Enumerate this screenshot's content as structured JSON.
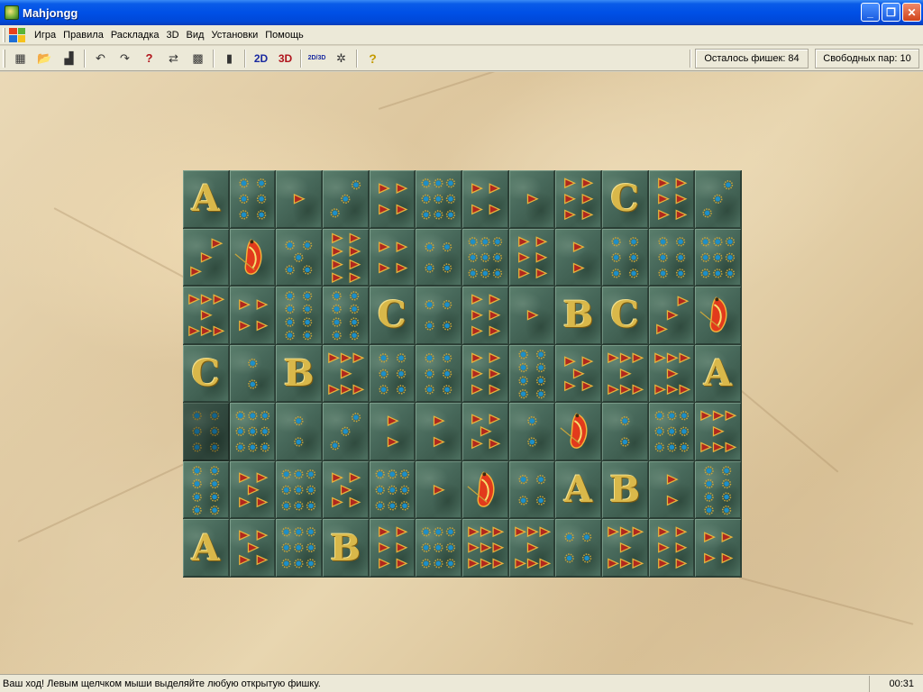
{
  "window": {
    "title": "Mahjongg",
    "minimize_icon": "minimize-icon",
    "maximize_icon": "restore-icon",
    "close_icon": "close-icon"
  },
  "menu": {
    "items": [
      "Игра",
      "Правила",
      "Раскладка",
      "3D",
      "Вид",
      "Установки",
      "Помощь"
    ]
  },
  "toolbar": {
    "buttons": [
      {
        "name": "new-game-icon",
        "glyph": "▦"
      },
      {
        "name": "open-icon",
        "glyph": "📂"
      },
      {
        "name": "layout-icon",
        "glyph": "▟"
      },
      {
        "name": "undo-icon",
        "glyph": "↶"
      },
      {
        "name": "redo-icon",
        "glyph": "↷"
      },
      {
        "name": "hint-icon",
        "glyph": "?"
      },
      {
        "name": "shuffle-icon",
        "glyph": "⇄"
      },
      {
        "name": "board-icon",
        "glyph": "▩"
      },
      {
        "name": "exit-icon",
        "glyph": "▮"
      }
    ],
    "view_2d": "2D",
    "view_3d": "3D",
    "toggle_2d3d": "2D/3D",
    "settings_icon": "✲",
    "help": "?",
    "tiles_left": "Осталось фишек: 84",
    "free_pairs": "Свободных пар: 10"
  },
  "board": {
    "rows": [
      [
        "A",
        "S6",
        "T1",
        "S3",
        "T4",
        "S9",
        "T4",
        "T1",
        "T6",
        "C",
        "T6",
        "S3"
      ],
      [
        "T3",
        "BIRD",
        "S5",
        "T8",
        "T4",
        "S4",
        "S9",
        "T6",
        "T2",
        "S6",
        "S6",
        "S9"
      ],
      [
        "T7",
        "T4",
        "S8",
        "S8",
        "C",
        "S4",
        "T6",
        "T1",
        "B",
        "C",
        "T3",
        "BIRD"
      ],
      [
        "C",
        "S2",
        "B",
        "T7",
        "S6",
        "S6",
        "T6",
        "S8",
        "T5",
        "T7",
        "T7",
        "A"
      ],
      [
        "S6d",
        "S9",
        "S2",
        "S3",
        "T2",
        "T2",
        "T5",
        "S2",
        "BIRD",
        "S2",
        "S9",
        "T7"
      ],
      [
        "S8",
        "T5",
        "S9",
        "T5",
        "S9",
        "T1",
        "BIRD",
        "S4",
        "A",
        "B",
        "T2",
        "S8"
      ],
      [
        "A",
        "T5",
        "S9",
        "B",
        "T6",
        "S9",
        "T9",
        "T7",
        "S4",
        "T7",
        "T6",
        "T4"
      ]
    ]
  },
  "status": {
    "message": "Ваш ход!  Левым щелчком мыши выделяйте любую открытую фишку.",
    "time": "00:31"
  },
  "colors": {
    "tile_green": "#47685a",
    "gold": "#d9b84a",
    "triangle_red": "#b0281e",
    "dot_blue": "#1d8fc8"
  }
}
